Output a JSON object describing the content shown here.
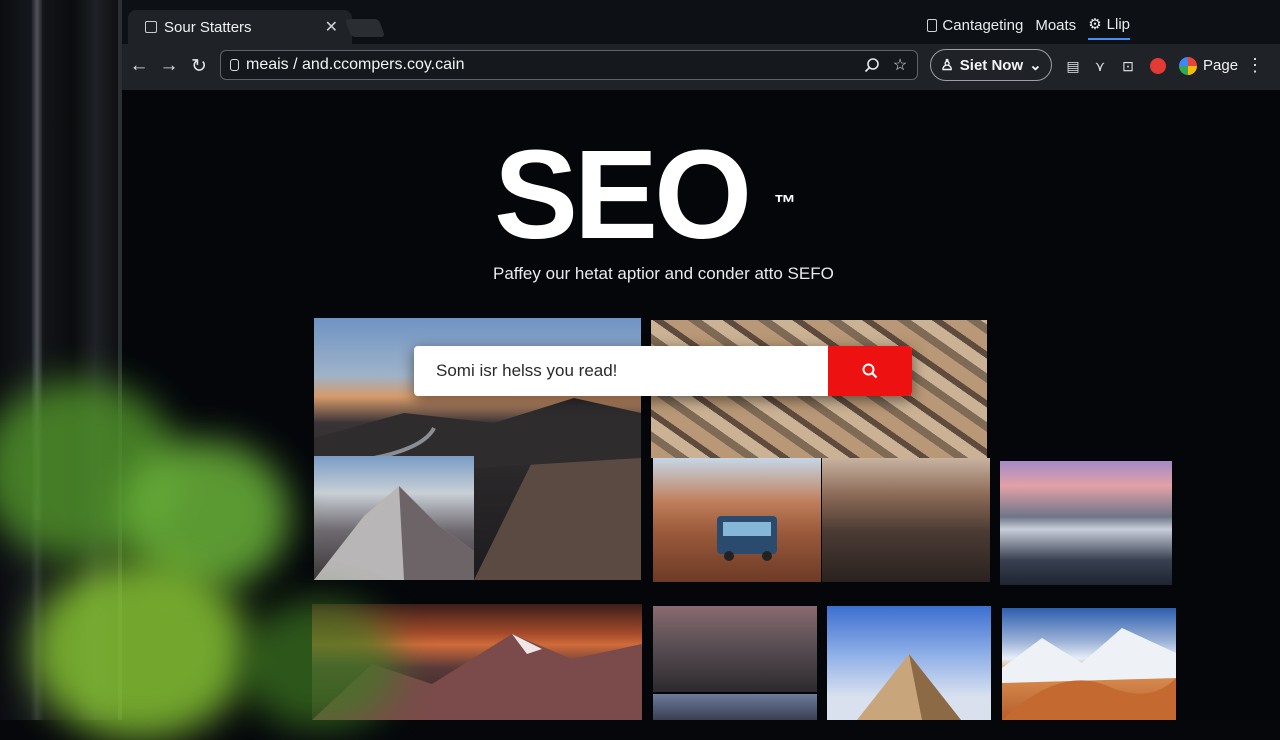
{
  "tab": {
    "title": "Sour Statters"
  },
  "top_links": [
    "Cantageting",
    "Moats",
    "Llip"
  ],
  "omnibox": {
    "url": "meais / and.ccompers.coy.cain"
  },
  "toolbar": {
    "start_button": "Siet Now",
    "page_label": "Page"
  },
  "hero": {
    "logo": "SEO",
    "trademark": "™",
    "tagline": "Paffey our hetat aptior and conder atto SEFO"
  },
  "search": {
    "value": "Somi isr helss you read!"
  },
  "colors": {
    "search_button": "#ee1111",
    "accent_underline": "#4a8df0"
  },
  "icons": [
    "back-arrow-icon",
    "forward-arrow-icon",
    "reload-icon",
    "lock-icon",
    "zoom-icon",
    "star-icon",
    "extension-icon",
    "share-icon",
    "camera-icon",
    "profile-icon",
    "chrome-icon",
    "more-icon",
    "search-icon",
    "gear-icon"
  ]
}
